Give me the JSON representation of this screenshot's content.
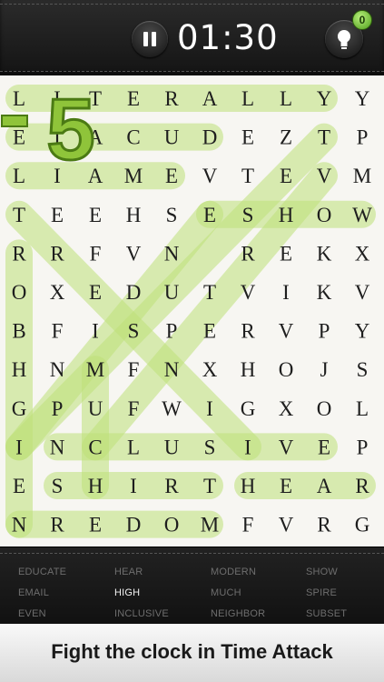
{
  "header": {
    "timer": "01:30",
    "hints_remaining": "0"
  },
  "grid": [
    [
      "L",
      "I",
      "T",
      "E",
      "R",
      "A",
      "L",
      "L",
      "Y",
      "Y"
    ],
    [
      "E",
      "T",
      "A",
      "C",
      "U",
      "D",
      "E",
      "Z",
      "T",
      "P"
    ],
    [
      "L",
      "I",
      "A",
      "M",
      "E",
      "V",
      "T",
      "E",
      "V",
      "M"
    ],
    [
      "T",
      "E",
      "E",
      "H",
      "S",
      "E",
      "S",
      "H",
      "O",
      "W"
    ],
    [
      "R",
      "R",
      "F",
      "V",
      "N",
      "",
      "R",
      "E",
      "K",
      "X"
    ],
    [
      "O",
      "X",
      "E",
      "D",
      "U",
      "T",
      "V",
      "I",
      "K",
      "V"
    ],
    [
      "B",
      "F",
      "I",
      "S",
      "P",
      "E",
      "R",
      "V",
      "P",
      "Y"
    ],
    [
      "H",
      "N",
      "M",
      "F",
      "N",
      "X",
      "H",
      "O",
      "J",
      "S"
    ],
    [
      "G",
      "P",
      "U",
      "F",
      "W",
      "I",
      "G",
      "X",
      "O",
      "L"
    ],
    [
      "I",
      "N",
      "C",
      "L",
      "U",
      "S",
      "I",
      "V",
      "E",
      "P"
    ],
    [
      "E",
      "S",
      "H",
      "I",
      "R",
      "T",
      "H",
      "E",
      "A",
      "R"
    ],
    [
      "N",
      "R",
      "E",
      "D",
      "O",
      "M",
      "F",
      "V",
      "R",
      "G"
    ]
  ],
  "penalty": "-5",
  "words": [
    [
      "EDUCATE",
      "HEAR",
      "MODERN",
      "SHOW"
    ],
    [
      "EMAIL",
      "HIGH",
      "MUCH",
      "SPIRE"
    ],
    [
      "EVEN",
      "INCLUSIVE",
      "NEIGHBOR",
      "SUBSET"
    ]
  ],
  "colors": {
    "highlight": "#bde078",
    "highlight_stroke": "#94c04a",
    "active_word": "#f2f2f2"
  },
  "banner": "Fight the clock in Time Attack"
}
